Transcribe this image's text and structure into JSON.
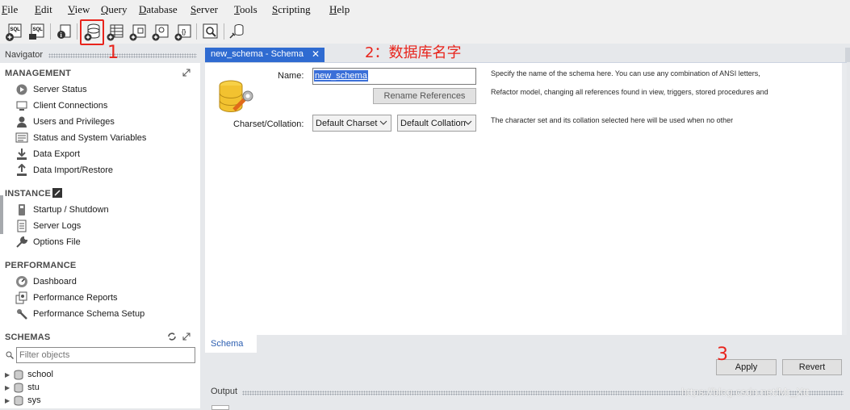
{
  "menu": [
    "File",
    "Edit",
    "View",
    "Query",
    "Database",
    "Server",
    "Tools",
    "Scripting",
    "Help"
  ],
  "toolbar": {
    "buttons": [
      "new-sql-tab-icon",
      "open-sql-file-icon",
      "inspector-icon",
      "create-schema-icon",
      "create-table-icon",
      "create-view-icon",
      "create-procedure-icon",
      "create-function-icon",
      "search-table-data-icon",
      "reconnect-icon"
    ]
  },
  "navigator": {
    "title": "Navigator",
    "management": {
      "title": "MANAGEMENT",
      "items": [
        "Server Status",
        "Client Connections",
        "Users and Privileges",
        "Status and System Variables",
        "Data Export",
        "Data Import/Restore"
      ]
    },
    "instance": {
      "title": "INSTANCE",
      "items": [
        "Startup / Shutdown",
        "Server Logs",
        "Options File"
      ]
    },
    "performance": {
      "title": "PERFORMANCE",
      "items": [
        "Dashboard",
        "Performance Reports",
        "Performance Schema Setup"
      ]
    },
    "schemas": {
      "title": "SCHEMAS",
      "filter_placeholder": "Filter objects",
      "items": [
        "school",
        "stu",
        "sys"
      ]
    }
  },
  "editor": {
    "tab_label": "new_schema - Schema",
    "name_label": "Name:",
    "name_value": "new_schema",
    "rename_button": "Rename References",
    "charset_label": "Charset/Collation:",
    "charset_value": "Default Charset",
    "collation_value": "Default Collation",
    "help_name_1": "Specify the name of the schema here. You can use any combination of ANSI letters,",
    "help_name_2": "Refactor model, changing all references found in view, triggers, stored procedures and",
    "help_charset": "The character set and its collation selected here will be used when no other",
    "bottom_tab": "Schema",
    "apply_button": "Apply",
    "revert_button": "Revert"
  },
  "output": {
    "title": "Output"
  },
  "annotations": {
    "step1": "1",
    "step2": "2：数据库名字",
    "step3": "3"
  },
  "watermark": "https://blog.csdn.net/Mr_Xtt",
  "colors": {
    "tab_active": "#2f6bd1",
    "annotation_red": "#e8241c",
    "selection": "#3a6fd8"
  }
}
